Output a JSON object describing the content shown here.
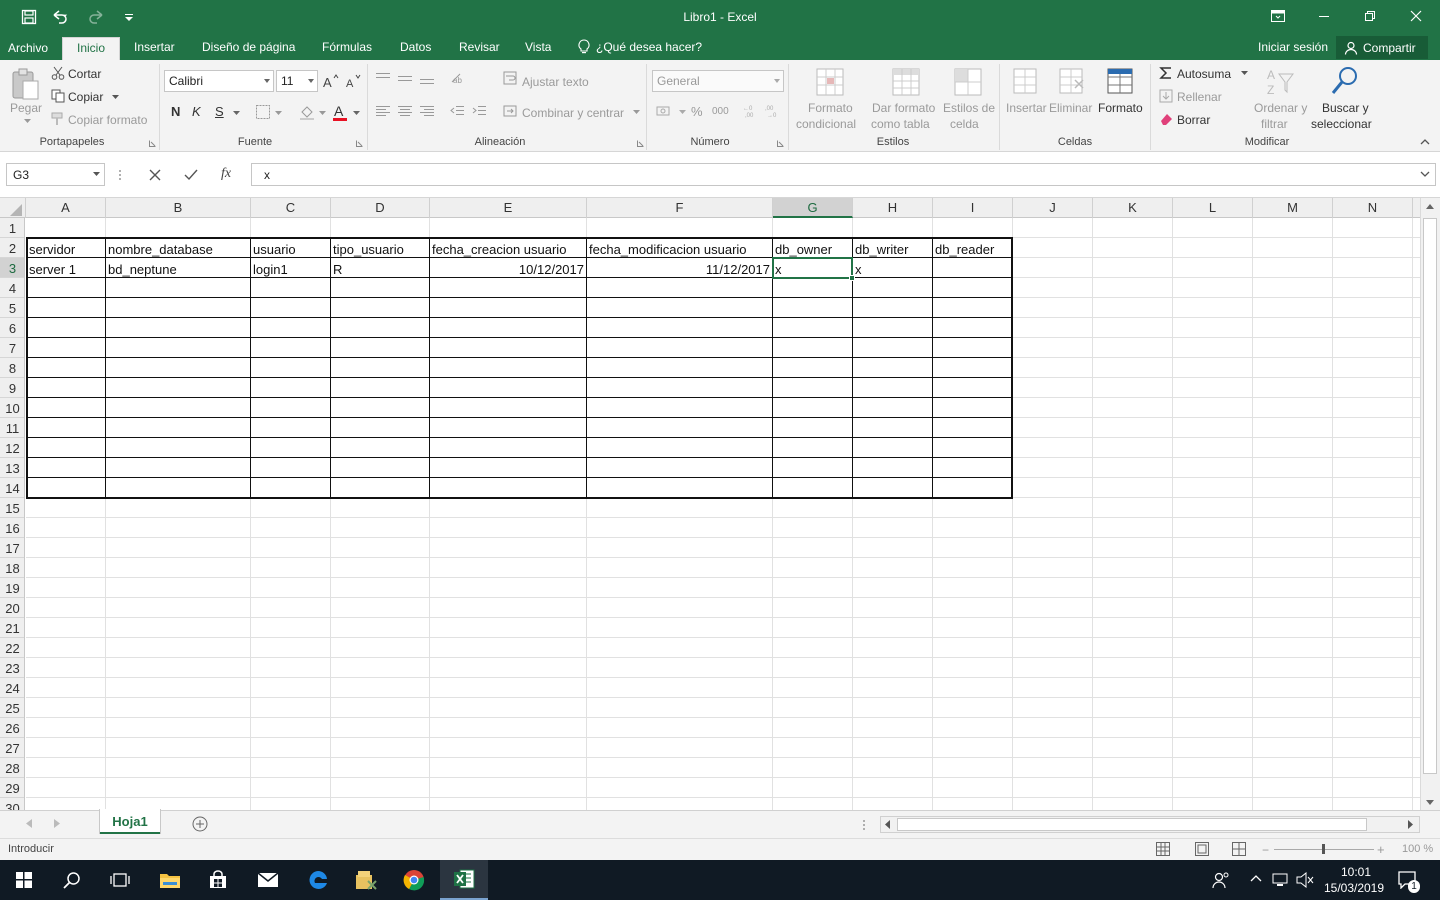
{
  "window": {
    "title": "Libro1 - Excel"
  },
  "menu": {
    "tabs": [
      "Archivo",
      "Inicio",
      "Insertar",
      "Diseño de página",
      "Fórmulas",
      "Datos",
      "Revisar",
      "Vista"
    ],
    "tell_me": "¿Qué desea hacer?",
    "sign_in": "Iniciar sesión",
    "share": "Compartir"
  },
  "ribbon": {
    "clipboard": {
      "paste": "Pegar",
      "cut": "Cortar",
      "copy": "Copiar",
      "format_painter": "Copiar formato",
      "label": "Portapapeles"
    },
    "font": {
      "name": "Calibri",
      "size": "11",
      "bold": "N",
      "italic": "K",
      "underline": "S",
      "label": "Fuente"
    },
    "alignment": {
      "wrap": "Ajustar texto",
      "merge": "Combinar y centrar",
      "label": "Alineación"
    },
    "number": {
      "format": "General",
      "percent": "%",
      "thousands": "000",
      "label": "Número"
    },
    "styles": {
      "conditional_1": "Formato",
      "conditional_2": "condicional",
      "table_1": "Dar formato",
      "table_2": "como tabla",
      "cell_1": "Estilos de",
      "cell_2": "celda",
      "label": "Estilos"
    },
    "cells": {
      "insert": "Insertar",
      "delete": "Eliminar",
      "format": "Formato",
      "label": "Celdas"
    },
    "editing": {
      "autosum": "Autosuma",
      "fill": "Rellenar",
      "clear": "Borrar",
      "sort_1": "Ordenar y",
      "sort_2": "filtrar",
      "find_1": "Buscar y",
      "find_2": "seleccionar",
      "label": "Modificar"
    }
  },
  "formula_bar": {
    "name_box": "G3",
    "fx": "fx",
    "content": "x"
  },
  "sheet": {
    "columns": [
      "A",
      "B",
      "C",
      "D",
      "E",
      "F",
      "G",
      "H",
      "I",
      "J",
      "K",
      "L",
      "M",
      "N"
    ],
    "rows": [
      "1",
      "2",
      "3",
      "4",
      "5",
      "6",
      "7",
      "8",
      "9",
      "10",
      "11",
      "12",
      "13",
      "14",
      "15",
      "16",
      "17",
      "18",
      "19",
      "20",
      "21",
      "22",
      "23",
      "24",
      "25",
      "26",
      "27",
      "28",
      "29",
      "30"
    ],
    "headers": [
      "servidor",
      "nombre_database",
      "usuario",
      "tipo_usuario",
      "fecha_creacion usuario",
      "fecha_modificacion usuario",
      "db_owner",
      "db_writer",
      "db_reader"
    ],
    "row3": [
      "server 1",
      "bd_neptune",
      "login1",
      "R",
      "10/12/2017",
      "11/12/2017",
      "x",
      "x",
      ""
    ],
    "active_cell": "G3",
    "tab": "Hoja1"
  },
  "status": {
    "mode": "Introducir",
    "zoom": "100 %"
  },
  "taskbar": {
    "time": "10:01",
    "date": "15/03/2019",
    "notifications": "1"
  }
}
